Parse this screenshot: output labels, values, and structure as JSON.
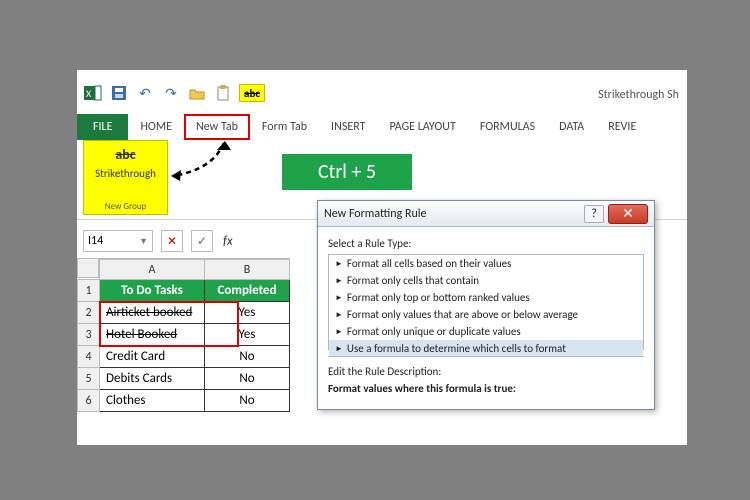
{
  "app": {
    "title_fragment": "Strikethrough Sh"
  },
  "qat": {
    "strikethrough_icon_text": "abc"
  },
  "ribbon": {
    "tabs": [
      "FILE",
      "HOME",
      "New Tab",
      "Form Tab",
      "INSERT",
      "PAGE LAYOUT",
      "FORMULAS",
      "DATA",
      "REVIE"
    ]
  },
  "group": {
    "icon_text": "abc",
    "label": "Strikethrough",
    "caption": "New Group"
  },
  "shortcut_label": "Ctrl + 5",
  "name_box": {
    "value": "I14"
  },
  "formula_bar": {
    "fx": "fx"
  },
  "grid": {
    "columns": [
      "A",
      "B"
    ],
    "rows": [
      {
        "n": "1",
        "a": "To Do Tasks",
        "b": "Completed",
        "header": true
      },
      {
        "n": "2",
        "a": "Airticket booked",
        "b": "Yes",
        "strike": true
      },
      {
        "n": "3",
        "a": "Hotel Booked",
        "b": "Yes",
        "strike": true
      },
      {
        "n": "4",
        "a": "Credit Card",
        "b": "No"
      },
      {
        "n": "5",
        "a": "Debits Cards",
        "b": "No"
      },
      {
        "n": "6",
        "a": "Clothes",
        "b": "No"
      }
    ]
  },
  "dialog": {
    "title": "New Formatting Rule",
    "select_label": "Select a Rule Type:",
    "rules": [
      "Format all cells based on their values",
      "Format only cells that contain",
      "Format only top or bottom ranked values",
      "Format only values that are above or below average",
      "Format only unique or duplicate values",
      "Use a formula to determine which cells to format"
    ],
    "edit_label": "Edit the Rule Description:",
    "formula_label": "Format values where this formula is true:",
    "help_glyph": "?",
    "close_glyph": "✕"
  }
}
